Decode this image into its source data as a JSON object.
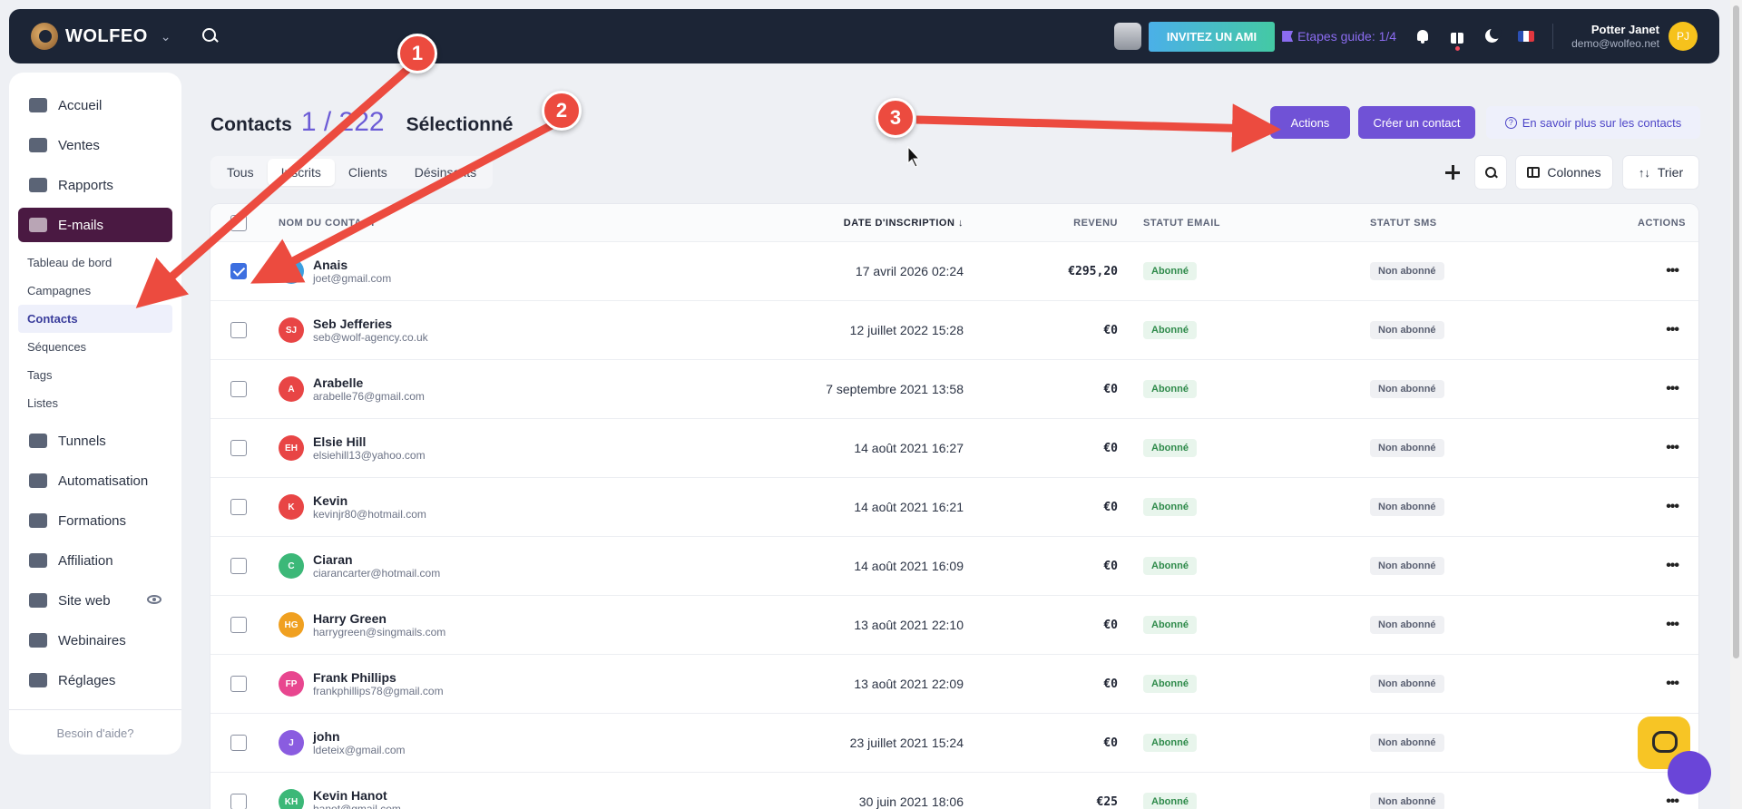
{
  "topbar": {
    "brand": "WOLFEO",
    "invite_label": "INVITEZ UN AMI",
    "guide_label": "Etapes guide: 1/4",
    "user_name": "Potter Janet",
    "user_email": "demo@wolfeo.net",
    "user_initials": "PJ"
  },
  "sidebar": {
    "items": [
      {
        "label": "Accueil",
        "icon": "home-icon"
      },
      {
        "label": "Ventes",
        "icon": "cart-icon"
      },
      {
        "label": "Rapports",
        "icon": "chart-icon"
      },
      {
        "label": "E-mails",
        "icon": "mail-icon"
      },
      {
        "label": "Tunnels",
        "icon": "funnel-icon"
      },
      {
        "label": "Automatisation",
        "icon": "bolt-icon"
      },
      {
        "label": "Formations",
        "icon": "graduation-icon"
      },
      {
        "label": "Affiliation",
        "icon": "money-icon"
      },
      {
        "label": "Site web",
        "icon": "link-icon"
      },
      {
        "label": "Webinaires",
        "icon": "video-icon"
      },
      {
        "label": "Réglages",
        "icon": "sliders-icon"
      }
    ],
    "subitems": [
      "Tableau de bord",
      "Campagnes",
      "Contacts",
      "Séquences",
      "Tags",
      "Listes"
    ],
    "help_label": "Besoin d'aide?"
  },
  "page": {
    "title": "Contacts",
    "count": "1 / 222",
    "selected": "Sélectionné",
    "actions_label": "Actions",
    "create_label": "Créer un contact",
    "learn_label": "En savoir plus sur les contacts"
  },
  "tabs": [
    "Tous",
    "Inscrits",
    "Clients",
    "Désinscrits"
  ],
  "toolbar": {
    "columns_label": "Colonnes",
    "sort_label": "Trier"
  },
  "table": {
    "headers": {
      "name": "NOM DU CONTACT",
      "date": "DATE D'INSCRIPTION",
      "revenue": "REVENU",
      "email_status": "STATUT EMAIL",
      "sms_status": "STATUT SMS",
      "actions": "ACTIONS"
    },
    "rows": [
      {
        "name": "Anais",
        "email": "joet@gmail.com",
        "initials": "",
        "color": "#3b9fe0",
        "date": "17 avril 2026 02:24",
        "revenue": "€295,20",
        "email_status": "Abonné",
        "sms_status": "Non abonné",
        "checked": true
      },
      {
        "name": "Seb Jefferies",
        "email": "seb@wolf-agency.co.uk",
        "initials": "SJ",
        "color": "#e84545",
        "date": "12 juillet 2022 15:28",
        "revenue": "€0",
        "email_status": "Abonné",
        "sms_status": "Non abonné",
        "checked": false
      },
      {
        "name": "Arabelle",
        "email": "arabelle76@gmail.com",
        "initials": "A",
        "color": "#e84545",
        "date": "7 septembre 2021 13:58",
        "revenue": "€0",
        "email_status": "Abonné",
        "sms_status": "Non abonné",
        "checked": false
      },
      {
        "name": "Elsie Hill",
        "email": "elsiehill13@yahoo.com",
        "initials": "EH",
        "color": "#e84545",
        "date": "14 août 2021 16:27",
        "revenue": "€0",
        "email_status": "Abonné",
        "sms_status": "Non abonné",
        "checked": false
      },
      {
        "name": "Kevin",
        "email": "kevinjr80@hotmail.com",
        "initials": "K",
        "color": "#e84545",
        "date": "14 août 2021 16:21",
        "revenue": "€0",
        "email_status": "Abonné",
        "sms_status": "Non abonné",
        "checked": false
      },
      {
        "name": "Ciaran",
        "email": "ciarancarter@hotmail.com",
        "initials": "C",
        "color": "#3cb878",
        "date": "14 août 2021 16:09",
        "revenue": "€0",
        "email_status": "Abonné",
        "sms_status": "Non abonné",
        "checked": false
      },
      {
        "name": "Harry Green",
        "email": "harrygreen@singmails.com",
        "initials": "HG",
        "color": "#f0a020",
        "date": "13 août 2021 22:10",
        "revenue": "€0",
        "email_status": "Abonné",
        "sms_status": "Non abonné",
        "checked": false
      },
      {
        "name": "Frank Phillips",
        "email": "frankphillips78@gmail.com",
        "initials": "FP",
        "color": "#e8468f",
        "date": "13 août 2021 22:09",
        "revenue": "€0",
        "email_status": "Abonné",
        "sms_status": "Non abonné",
        "checked": false
      },
      {
        "name": "john",
        "email": "ldeteix@gmail.com",
        "initials": "J",
        "color": "#8a5ce0",
        "date": "23 juillet 2021 15:24",
        "revenue": "€0",
        "email_status": "Abonné",
        "sms_status": "Non abonné",
        "checked": false
      },
      {
        "name": "Kevin Hanot",
        "email": "hanot@gmail.com",
        "initials": "KH",
        "color": "#3cb878",
        "date": "30 juin 2021 18:06",
        "revenue": "€25",
        "email_status": "Abonné",
        "sms_status": "Non abonné",
        "checked": false
      }
    ]
  },
  "annotations": [
    "1",
    "2",
    "3"
  ],
  "colors": {
    "accent": "#7052d6",
    "active_nav": "#4a1942",
    "marker": "#ec4b3f"
  }
}
